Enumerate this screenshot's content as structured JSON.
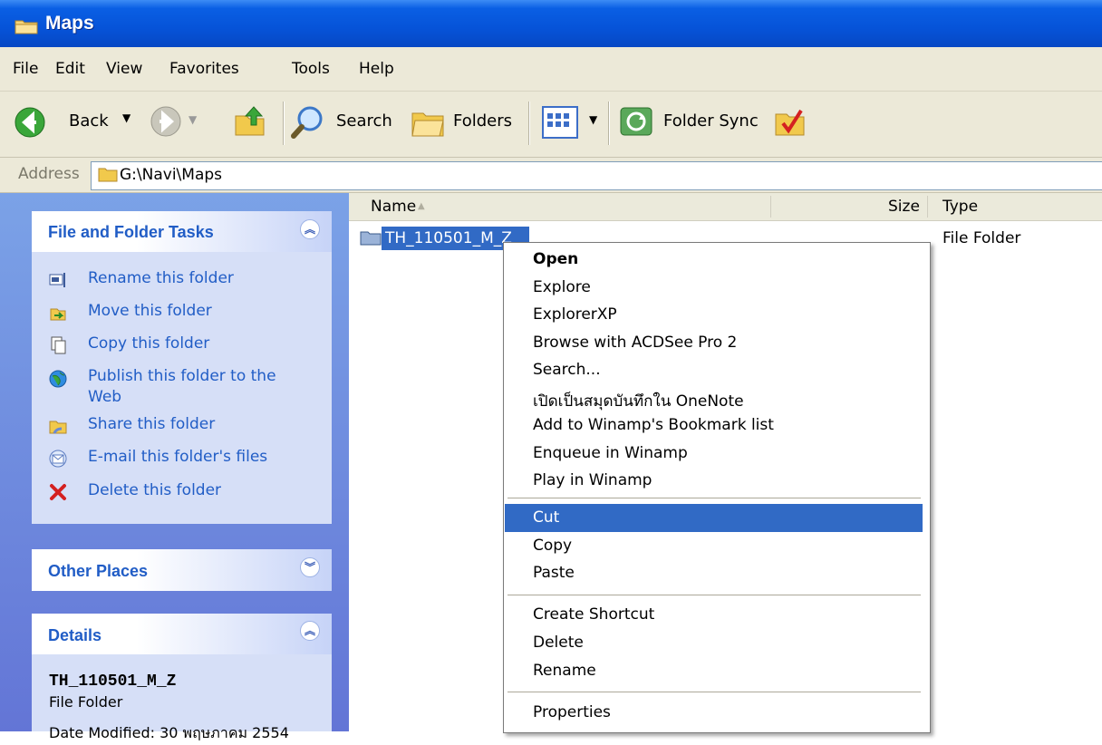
{
  "window": {
    "title": "Maps"
  },
  "menu": [
    "File",
    "Edit",
    "View",
    "Favorites",
    "Tools",
    "Help"
  ],
  "toolbar": {
    "back_label": "Back",
    "search_label": "Search",
    "folders_label": "Folders",
    "sync_label": "Folder Sync"
  },
  "address": {
    "label": "Address",
    "path": "G:\\Navi\\Maps"
  },
  "tasks": {
    "title": "File and Folder Tasks",
    "items": [
      {
        "label": "Rename this folder",
        "icon": "rename-icon"
      },
      {
        "label": "Move this folder",
        "icon": "move-icon"
      },
      {
        "label": "Copy this folder",
        "icon": "copy-icon"
      },
      {
        "label": "Publish this folder to the",
        "label2": "Web",
        "icon": "globe-icon"
      },
      {
        "label": "Share this folder",
        "icon": "share-icon"
      },
      {
        "label": "E-mail this folder's files",
        "icon": "email-icon"
      },
      {
        "label": "Delete this folder",
        "icon": "delete-icon"
      }
    ]
  },
  "other_places": {
    "title": "Other Places"
  },
  "details": {
    "title": "Details",
    "name": "TH_110501_M_Z",
    "type": "File Folder",
    "modified": "Date Modified: 30 พฤษภาคม 2554"
  },
  "columns": {
    "name": "Name",
    "size": "Size",
    "type": "Type"
  },
  "row": {
    "name": "TH_110501_M_Z",
    "type": "File Folder"
  },
  "context_menu": {
    "group1": [
      "Open",
      "Explore",
      "ExplorerXP",
      "Browse with ACDSee Pro 2",
      "Search...",
      "เปิดเป็นสมุดบันทึกใน OneNote",
      "Add to Winamp's Bookmark list",
      "Enqueue in Winamp",
      "Play in Winamp"
    ],
    "group2": [
      "Cut",
      "Copy",
      "Paste"
    ],
    "group3": [
      "Create Shortcut",
      "Delete",
      "Rename"
    ],
    "group4": [
      "Properties"
    ],
    "highlighted": "Cut"
  },
  "colors": {
    "title_bar": "#0653d8",
    "selection": "#316ac5",
    "task_link": "#215dc6",
    "pane_bg": "#6375d6"
  }
}
